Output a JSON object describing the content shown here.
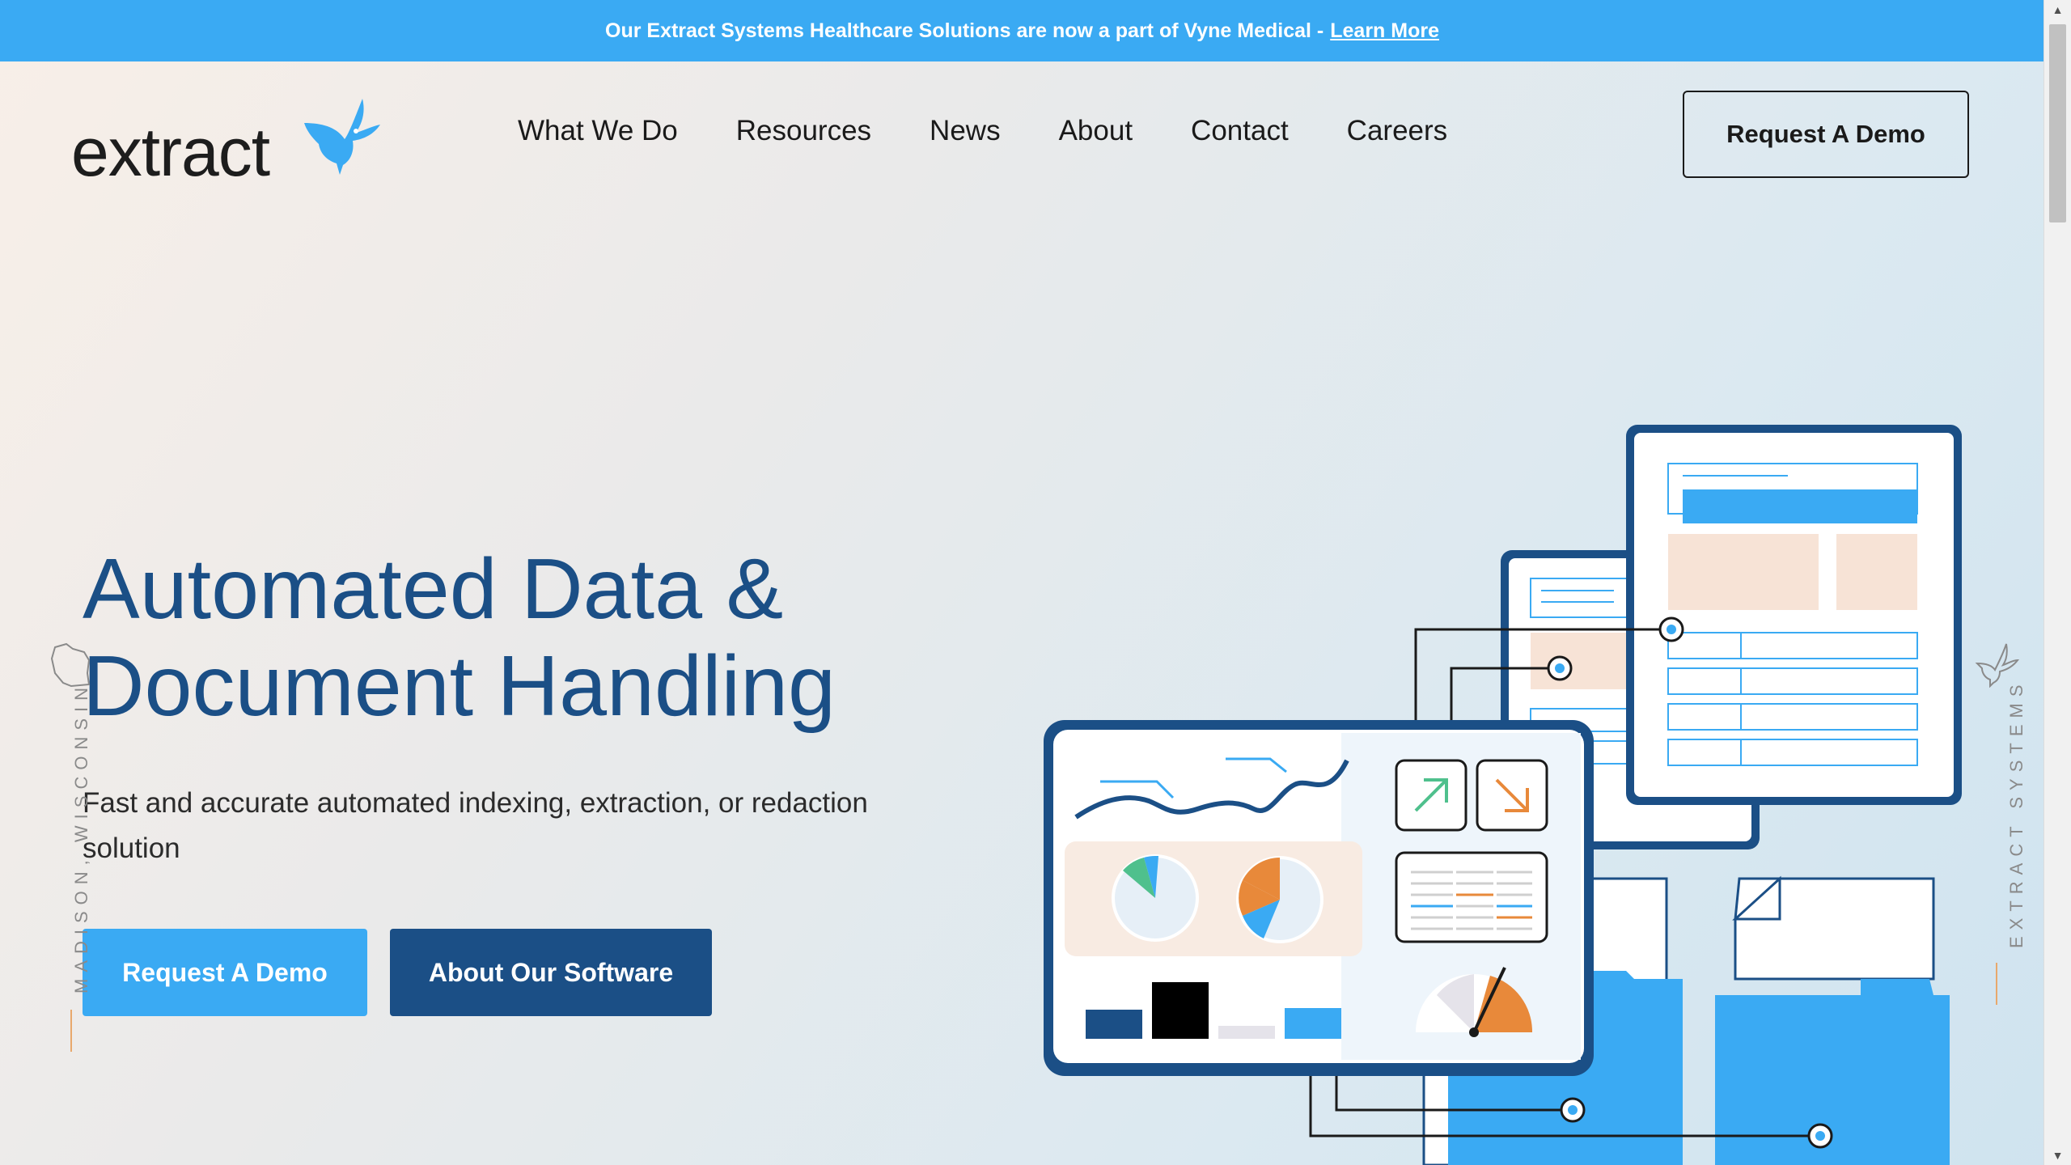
{
  "announcement": {
    "text": "Our Extract Systems Healthcare Solutions are now a part of Vyne Medical -",
    "link_label": "Learn More"
  },
  "logo": {
    "text": "extract"
  },
  "nav": {
    "items": [
      {
        "label": "What We Do"
      },
      {
        "label": "Resources"
      },
      {
        "label": "News"
      },
      {
        "label": "About"
      },
      {
        "label": "Contact"
      },
      {
        "label": "Careers"
      }
    ],
    "cta_label": "Request A Demo"
  },
  "hero": {
    "title_line1": "Automated Data &",
    "title_line2": "Document Handling",
    "subtitle": "Fast and accurate automated indexing, extraction, or redaction solution",
    "primary_button": "Request A Demo",
    "secondary_button": "About Our Software"
  },
  "side": {
    "left_text": "MADISON, WISCONSIN",
    "right_text": "EXTRACT SYSTEMS"
  },
  "colors": {
    "accent_blue": "#3aaaf3",
    "navy": "#1b4f86",
    "orange": "#e8893a",
    "peach": "#f7e3d6"
  },
  "icons": [
    "hummingbird-icon",
    "wisconsin-map-icon",
    "arrow-up-right-icon",
    "arrow-down-right-icon",
    "scroll-up-icon",
    "scroll-down-icon"
  ]
}
